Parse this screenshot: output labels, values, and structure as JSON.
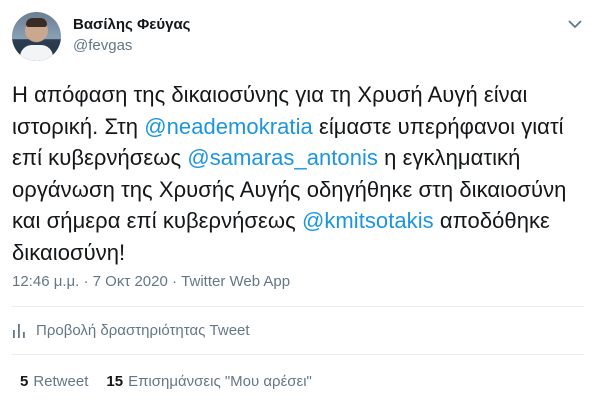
{
  "author": {
    "display_name": "Βασίλης Φεύγας",
    "handle": "@fevgas"
  },
  "tweet": {
    "segments": [
      {
        "text": "Η απόφαση της δικαιοσύνης για τη Χρυσή Αυγή  είναι ιστορική. Στη ",
        "mention": false
      },
      {
        "text": "@neademokratia",
        "mention": true
      },
      {
        "text": " είμαστε υπερήφανοι γιατί επί κυβερνήσεως ",
        "mention": false
      },
      {
        "text": "@samaras_antonis",
        "mention": true
      },
      {
        "text": " η εγκληματική οργάνωση της Χρυσής Αυγής οδηγήθηκε στη δικαιοσύνη και σήμερα επί κυβερνήσεως ",
        "mention": false
      },
      {
        "text": "@kmitsotakis",
        "mention": true
      },
      {
        "text": " αποδόθηκε δικαιοσύνη!",
        "mention": false
      }
    ]
  },
  "meta": {
    "time": "12:46 μ.μ.",
    "separator": " · ",
    "date": "7 Οκτ 2020",
    "source": "Twitter Web App"
  },
  "analytics": {
    "label": "Προβολή δραστηριότητας Tweet",
    "icon": "bar-chart-icon"
  },
  "stats": {
    "retweets_count": "5",
    "retweets_label": "Retweet",
    "likes_count": "15",
    "likes_label": "Επισημάνσεις \"Μου αρέσει\""
  },
  "colors": {
    "text": "#14171a",
    "secondary": "#657786",
    "link": "#1b95e0",
    "divider": "#e6ecf0"
  }
}
